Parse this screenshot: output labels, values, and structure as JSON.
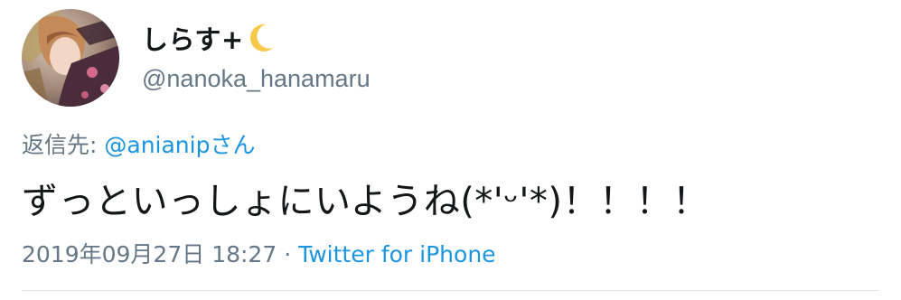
{
  "user": {
    "display_name": "しらす+",
    "handle": "@nanoka_hanamaru"
  },
  "reply": {
    "prefix": "返信先: ",
    "mention": "@anianipさん"
  },
  "tweet": {
    "text": "ずっといっしょにいようね(*'ᵕ'*)！！！！"
  },
  "meta": {
    "timestamp": "2019年09月27日 18:27",
    "separator": " · ",
    "source": "Twitter for iPhone"
  },
  "colors": {
    "text": "#14171a",
    "secondary": "#657786",
    "link": "#1b95e0",
    "divider": "#e1e8ed"
  },
  "icons": {
    "display_name_emoji": "crescent-moon-icon"
  }
}
